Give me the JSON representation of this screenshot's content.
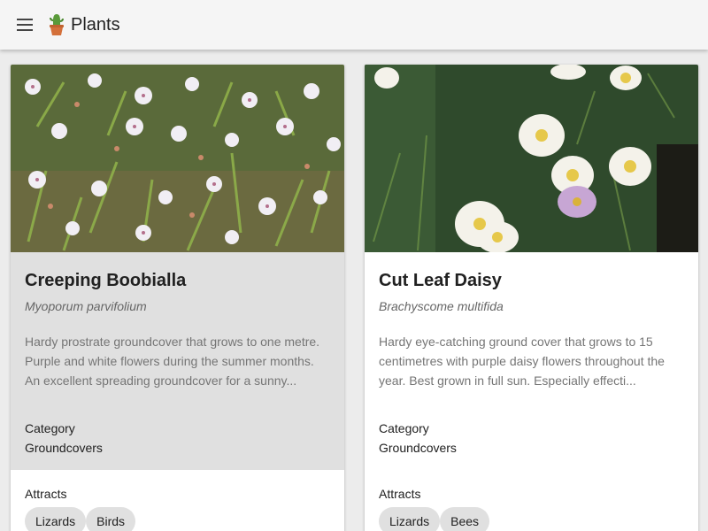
{
  "appbar": {
    "title": "Plants",
    "menu_icon": "hamburger-menu-icon",
    "logo_icon": "potted-cactus-icon"
  },
  "colors": {
    "appbar_bg": "#f5f5f5",
    "card_hover_bg": "#e0e0e0",
    "chip_bg": "#e0e0e0"
  },
  "cards": [
    {
      "title": "Creeping Boobialla",
      "scientific_name": "Myoporum parvifolium",
      "description": "Hardy prostrate groundcover that grows to one metre. Purple and white flowers during the summer months. An excellent spreading groundcover for a sunny...",
      "category_label": "Category",
      "category_value": "Groundcovers",
      "attracts_label": "Attracts",
      "attracts": [
        "Lizards",
        "Birds"
      ],
      "image": "white-star-flowers-photo"
    },
    {
      "title": "Cut Leaf Daisy",
      "scientific_name": "Brachyscome multifida",
      "description": "Hardy eye-catching ground cover that grows to 15 centimetres with purple daisy flowers throughout the year. Best grown in full sun. Especially effecti...",
      "category_label": "Category",
      "category_value": "Groundcovers",
      "attracts_label": "Attracts",
      "attracts": [
        "Lizards",
        "Bees"
      ],
      "image": "daisy-flowers-photo"
    }
  ]
}
